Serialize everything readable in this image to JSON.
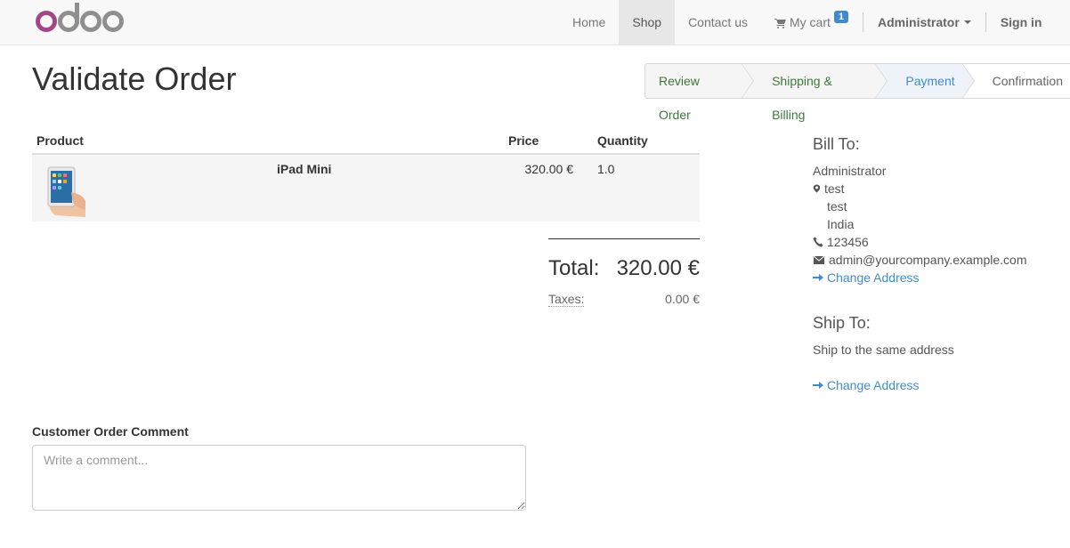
{
  "navbar": {
    "brand": "odoo",
    "items": [
      {
        "label": "Home"
      },
      {
        "label": "Shop"
      },
      {
        "label": "Contact us"
      }
    ],
    "cart_label": "My cart",
    "cart_count": "1",
    "user_label": "Administrator",
    "sign_in": "Sign in"
  },
  "page_title": "Validate Order",
  "wizard": {
    "steps": [
      {
        "label": "Review Order",
        "state": "done"
      },
      {
        "label": "Shipping & Billing",
        "state": "done"
      },
      {
        "label": "Payment",
        "state": "current"
      },
      {
        "label": "Confirmation",
        "state": "todo"
      }
    ]
  },
  "order_table": {
    "headers": {
      "product": "Product",
      "price": "Price",
      "quantity": "Quantity"
    },
    "rows": [
      {
        "name": "iPad Mini",
        "price": "320.00 €",
        "quantity": "1.0",
        "image": "ipad-mini"
      }
    ]
  },
  "totals": {
    "total_label": "Total:",
    "total_value": "320.00 €",
    "taxes_label": "Taxes:",
    "taxes_value": "0.00 €"
  },
  "bill_to": {
    "heading": "Bill To:",
    "name": "Administrator",
    "street": "test",
    "city": "test",
    "country": "India",
    "phone": "123456",
    "email": "admin@yourcompany.example.com",
    "change_link": "Change Address"
  },
  "ship_to": {
    "heading": "Ship To:",
    "text": "Ship to the same address",
    "change_link": "Change Address"
  },
  "comment": {
    "label": "Customer Order Comment",
    "placeholder": "Write a comment..."
  },
  "colors": {
    "brand_purple": "#a24689",
    "link_blue": "#428bca",
    "done_step_green": "#3a7a3a"
  }
}
